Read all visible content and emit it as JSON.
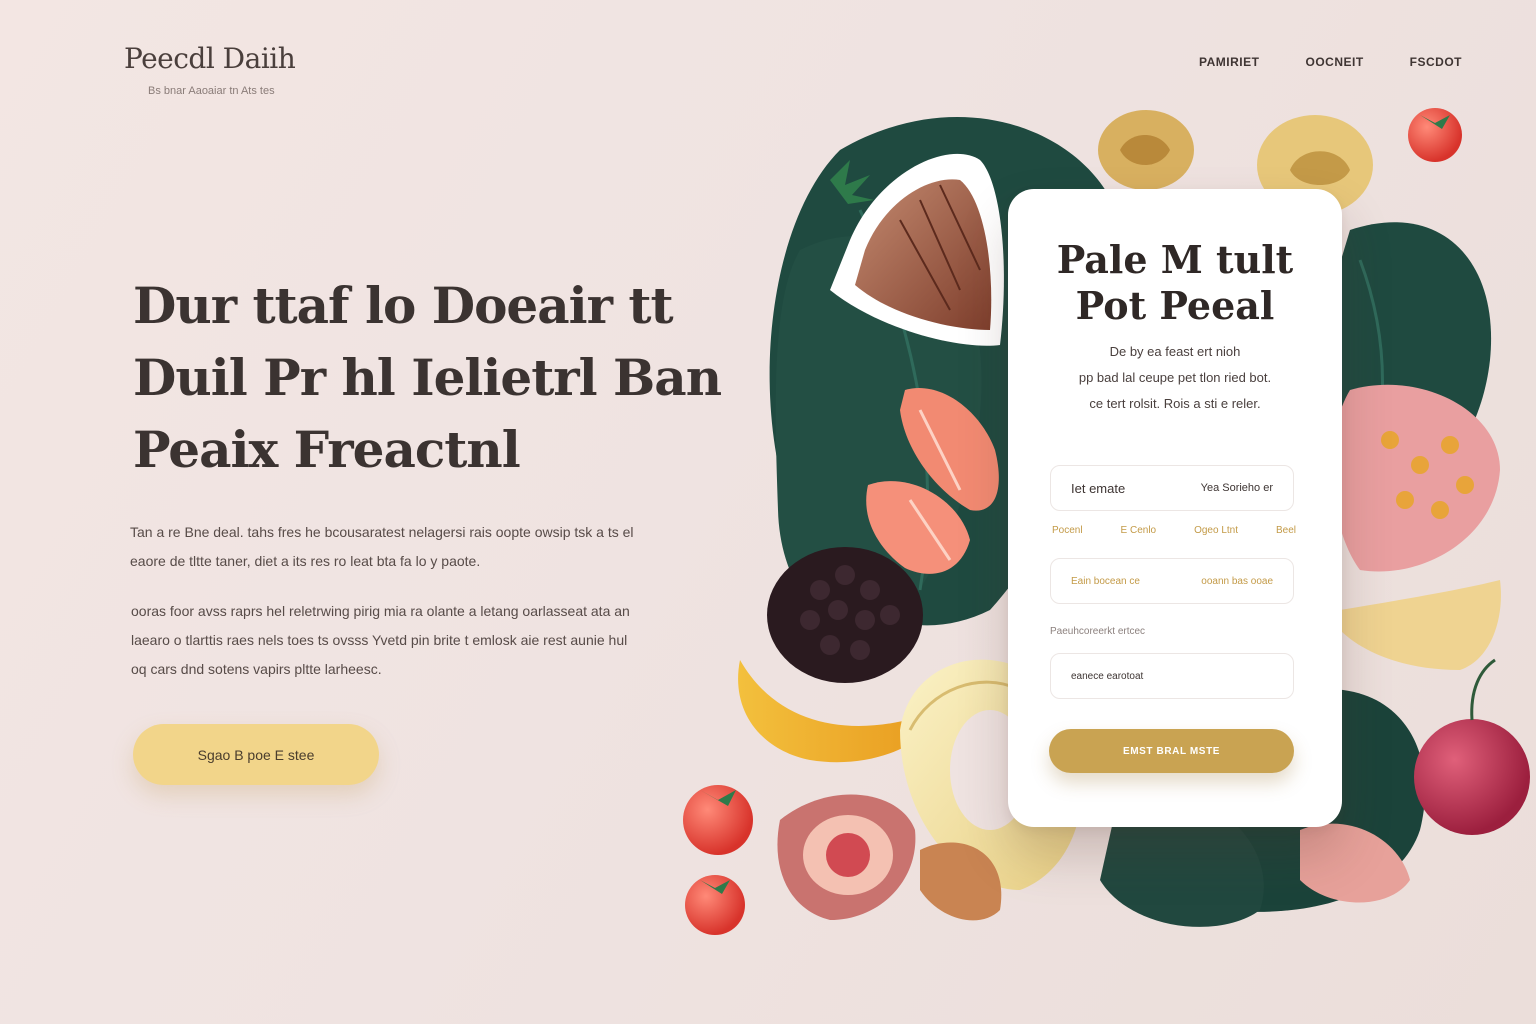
{
  "brand": {
    "title": "Peecdl Daiih",
    "tagline": "Bs bnar Aaoaiar tn Ats tes"
  },
  "nav": {
    "items": [
      "PAMIRIET",
      "OOCNEIT",
      "FSCDOT"
    ]
  },
  "hero": {
    "headline": [
      "Dur ttaf lo Doeair tt",
      "Duil Pr hl Ielietrl Ban",
      "Peaix Freactnl"
    ],
    "description": [
      "Tan a re Bne deal. tahs fres he bcousaratest nelagersi rais oopte owsip tsk a ts el",
      "eaore de tltte taner, diet a its res ro leat bta fa lo y paote."
    ],
    "description2": [
      "ooras foor avss raprs hel reletrwing pirig mia ra olante a letang oarlasseat ata an",
      "laearo o tlarttis raes nels toes ts ovsss Yvetd pin brite t emlosk aie rest aunie hul",
      "oq cars dnd sotens vapirs pltte larheesc."
    ],
    "cta_label": "Sgao B poe E stee"
  },
  "card": {
    "title": [
      "Pale M tult",
      "Pot Peeal"
    ],
    "subtitle": [
      "De by ea feast ert nioh",
      "pp bad lal ceupe pet tlon ried bot.",
      "ce tert rolsit. Rois a sti e reler."
    ],
    "field1": {
      "left": "Iet emate",
      "right": "Yea Sorieho er"
    },
    "options": [
      "Pocenl",
      "E Cenlo",
      "Ogeo Ltnt",
      "Beel"
    ],
    "field2": {
      "left": "Eain bocean ce",
      "right": "ooann bas ooae"
    },
    "field3_label": "Paeuhcoreerkt ertcec",
    "field3": {
      "value": "eanece earotoat"
    },
    "submit_label": "EMST BRAL MSTE"
  },
  "colors": {
    "accent": "#c9a352",
    "cta": "#f2d58a",
    "background": "#efe3e1",
    "leaf": "#1f4a40"
  }
}
